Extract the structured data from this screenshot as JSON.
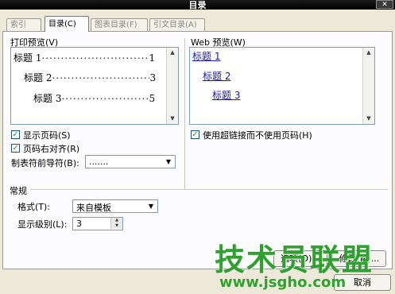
{
  "window": {
    "title": "目录",
    "close_glyph": "✕"
  },
  "tabs": [
    {
      "label": "索引(X)",
      "active": false
    },
    {
      "label": "目录(C)",
      "active": true
    },
    {
      "label": "图表目录(F)",
      "active": false
    },
    {
      "label": "引文目录(A)",
      "active": false
    }
  ],
  "print_preview": {
    "label": "打印预览(V)",
    "entries": [
      {
        "text": "标题 1",
        "page": "1",
        "level": 1
      },
      {
        "text": "标题 2",
        "page": "3",
        "level": 2
      },
      {
        "text": "标题 3",
        "page": "5",
        "level": 3
      }
    ]
  },
  "web_preview": {
    "label": "Web 预览(W)",
    "links": [
      "标题 1",
      "标题 2",
      "标题 3"
    ]
  },
  "options": {
    "show_page_numbers": {
      "label": "显示页码(S)",
      "checked": true
    },
    "right_align": {
      "label": "页码右对齐(R)",
      "checked": true
    },
    "tab_leader": {
      "label": "制表符前导符(B):",
      "value": "......."
    },
    "use_hyperlinks": {
      "label": "使用超链接而不使用页码(H)",
      "checked": true
    }
  },
  "general": {
    "heading": "常规",
    "format": {
      "label": "格式(T):",
      "value": "来自模板"
    },
    "levels": {
      "label": "显示级别(L):",
      "value": "3"
    }
  },
  "buttons": {
    "options": "选项(O)...",
    "modify": "修改(M)...",
    "cancel": "取消"
  },
  "watermark": {
    "text": "技术员联盟",
    "url": "www.jsgho.com"
  },
  "colors": {
    "accent_green": "#2ea12e",
    "link_blue": "#1a1aa6"
  }
}
